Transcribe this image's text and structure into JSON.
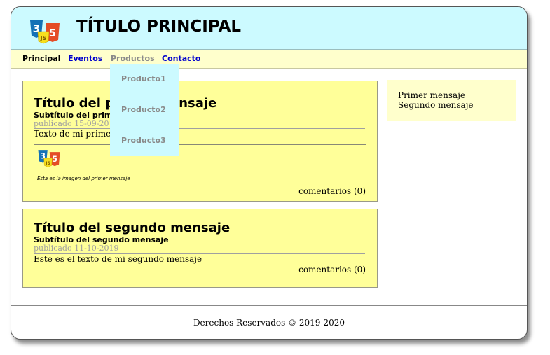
{
  "header": {
    "title": "TÍTULO PRINCIPAL",
    "logo": "css3-js-html5-logo"
  },
  "nav": {
    "items": [
      {
        "label": "Principal"
      },
      {
        "label": "Eventos"
      },
      {
        "label": "Productos"
      },
      {
        "label": "Contacto"
      }
    ]
  },
  "dropdown": {
    "items": [
      {
        "label": "Producto1"
      },
      {
        "label": "Producto2"
      },
      {
        "label": "Producto3"
      }
    ]
  },
  "posts": [
    {
      "title": "Título del primer mensaje",
      "subtitle": "Subtítulo del primer mensaje",
      "date": "publicado 15-09-2019",
      "text": "Texto de mi primer mensaje",
      "figure": {
        "image": "css3-js-html5-logo",
        "caption": "Esta es la imagen del primer mensaje"
      },
      "comments": "comentarios (0)"
    },
    {
      "title": "Título del segundo mensaje",
      "subtitle": "Subtítulo del segundo mensaje",
      "date": "publicado 11-10-2019",
      "text": "Este es el texto de mi segundo mensaje",
      "comments": "comentarios (0)"
    }
  ],
  "aside": {
    "items": [
      "Primer mensaje",
      "Segundo mensaje"
    ]
  },
  "footer": {
    "text": "Derechos Reservados © 2019-2020"
  },
  "colors": {
    "header_bg": "#ccfaff",
    "nav_bg": "#ffffcc",
    "post_bg": "#ffff99",
    "link": "#0000cc",
    "active_link": "#8a8a8a"
  }
}
